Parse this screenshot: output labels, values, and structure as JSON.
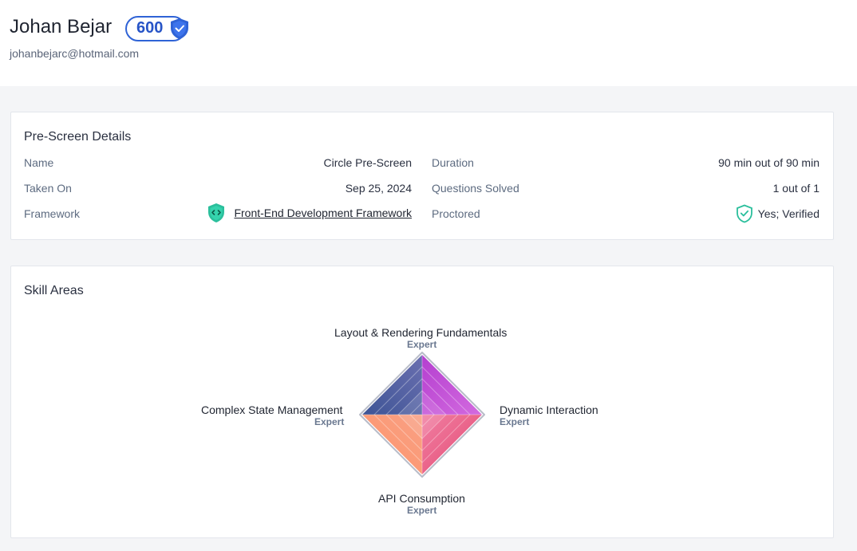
{
  "profile": {
    "name": "Johan Bejar",
    "score": "600",
    "email": "johanbejarc@hotmail.com"
  },
  "prescreen": {
    "title": "Pre-Screen Details",
    "name_label": "Name",
    "name_value": "Circle Pre-Screen",
    "taken_label": "Taken On",
    "taken_value": "Sep 25, 2024",
    "framework_label": "Framework",
    "framework_value": "Front-End Development Framework",
    "duration_label": "Duration",
    "duration_value": "90 min out of 90 min",
    "questions_label": "Questions Solved",
    "questions_value": "1 out of 1",
    "proctored_label": "Proctored",
    "proctored_value": "Yes; Verified"
  },
  "skills": {
    "title": "Skill Areas",
    "axes": [
      {
        "name": "Layout & Rendering Fundamentals",
        "level": "Expert"
      },
      {
        "name": "Dynamic Interaction",
        "level": "Expert"
      },
      {
        "name": "API Consumption",
        "level": "Expert"
      },
      {
        "name": "Complex State Management",
        "level": "Expert"
      }
    ]
  },
  "colors": {
    "accent_blue": "#2f63d6",
    "teal": "#2bbf9c",
    "quad_top_left": "#4a5fa3",
    "quad_top_right": "#c24fd8",
    "quad_bottom_right": "#e8557a",
    "quad_bottom_left": "#ff9a6e"
  }
}
